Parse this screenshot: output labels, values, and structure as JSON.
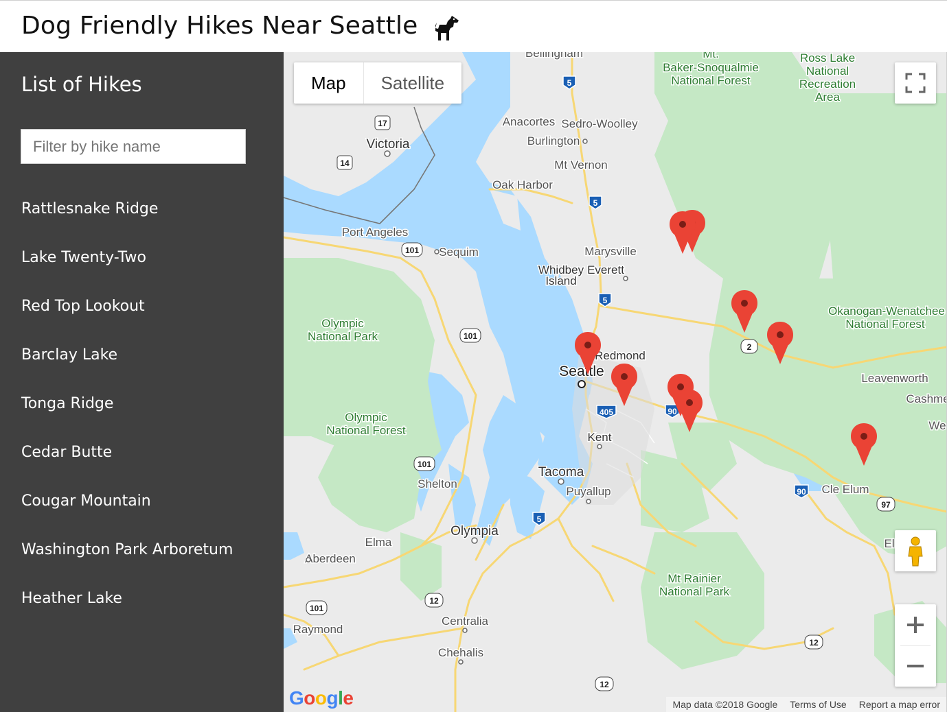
{
  "header": {
    "title": "Dog Friendly Hikes Near Seattle",
    "icon": "dog-icon"
  },
  "sidebar": {
    "heading": "List of Hikes",
    "filter_placeholder": "Filter by hike name",
    "filter_value": "",
    "hikes": [
      "Rattlesnake Ridge",
      "Lake Twenty-Two",
      "Red Top Lookout",
      "Barclay Lake",
      "Tonga Ridge",
      "Cedar Butte",
      "Cougar Mountain",
      "Washington Park Arboretum",
      "Heather Lake"
    ]
  },
  "map": {
    "type_control": {
      "map_label": "Map",
      "satellite_label": "Satellite",
      "selected": "Map"
    },
    "attribution": {
      "map_data": "Map data ©2018 Google",
      "terms": "Terms of Use",
      "report": "Report a map error"
    },
    "logo_letters": [
      "G",
      "o",
      "o",
      "g",
      "l",
      "e"
    ],
    "marker_count": 10,
    "labels": [
      {
        "id": "bellingham",
        "text": "Bellingham",
        "kind": "city"
      },
      {
        "id": "mt-baker-1",
        "text": "Mt.",
        "kind": "park"
      },
      {
        "id": "mt-baker-2",
        "text": "Baker-Snoqualmie",
        "kind": "park"
      },
      {
        "id": "mt-baker-3",
        "text": "National Forest",
        "kind": "park"
      },
      {
        "id": "ross-1",
        "text": "Ross Lake",
        "kind": "park"
      },
      {
        "id": "ross-2",
        "text": "National",
        "kind": "park"
      },
      {
        "id": "ross-3",
        "text": "Recreation",
        "kind": "park"
      },
      {
        "id": "ross-4",
        "text": "Area",
        "kind": "park"
      },
      {
        "id": "victoria",
        "text": "Victoria",
        "kind": "city-major"
      },
      {
        "id": "anacortes",
        "text": "Anacortes",
        "kind": "city"
      },
      {
        "id": "sedro",
        "text": "Sedro-Woolley",
        "kind": "city"
      },
      {
        "id": "burlington",
        "text": "Burlington",
        "kind": "city"
      },
      {
        "id": "mtvernon",
        "text": "Mt Vernon",
        "kind": "city"
      },
      {
        "id": "oakharbor",
        "text": "Oak Harbor",
        "kind": "city"
      },
      {
        "id": "portangeles",
        "text": "Port Angeles",
        "kind": "city"
      },
      {
        "id": "sequim",
        "text": "Sequim",
        "kind": "city"
      },
      {
        "id": "marysville",
        "text": "Marysville",
        "kind": "city"
      },
      {
        "id": "whidbey-1",
        "text": "Whidbey",
        "kind": "city-dark"
      },
      {
        "id": "whidbey-2",
        "text": "Island",
        "kind": "city-dark"
      },
      {
        "id": "everett",
        "text": "Everett",
        "kind": "city-dark"
      },
      {
        "id": "olympic-np-1",
        "text": "Olympic",
        "kind": "park"
      },
      {
        "id": "olympic-np-2",
        "text": "National Park",
        "kind": "park"
      },
      {
        "id": "okanogan-1",
        "text": "Okanogan-Wenatchee",
        "kind": "park"
      },
      {
        "id": "okanogan-2",
        "text": "National Forest",
        "kind": "park"
      },
      {
        "id": "redmond",
        "text": "Redmond",
        "kind": "city-dark"
      },
      {
        "id": "seattle",
        "text": "Seattle",
        "kind": "city-major"
      },
      {
        "id": "leavenworth",
        "text": "Leavenworth",
        "kind": "city"
      },
      {
        "id": "cashmere",
        "text": "Cashme",
        "kind": "city"
      },
      {
        "id": "olympic-nf-1",
        "text": "Olympic",
        "kind": "park"
      },
      {
        "id": "olympic-nf-2",
        "text": "National Forest",
        "kind": "park"
      },
      {
        "id": "kent",
        "text": "Kent",
        "kind": "city-dark"
      },
      {
        "id": "we",
        "text": "We",
        "kind": "city"
      },
      {
        "id": "shelton",
        "text": "Shelton",
        "kind": "city"
      },
      {
        "id": "tacoma",
        "text": "Tacoma",
        "kind": "city-major"
      },
      {
        "id": "puyallup",
        "text": "Puyallup",
        "kind": "city"
      },
      {
        "id": "cle-elum",
        "text": "Cle Elum",
        "kind": "city"
      },
      {
        "id": "olympia",
        "text": "Olympia",
        "kind": "city-major"
      },
      {
        "id": "elma",
        "text": "Elma",
        "kind": "city"
      },
      {
        "id": "aberdeen",
        "text": "Aberdeen",
        "kind": "city"
      },
      {
        "id": "el",
        "text": "El",
        "kind": "city"
      },
      {
        "id": "rainier-1",
        "text": "Mt Rainier",
        "kind": "park"
      },
      {
        "id": "rainier-2",
        "text": "National Park",
        "kind": "park"
      },
      {
        "id": "centralia",
        "text": "Centralia",
        "kind": "city"
      },
      {
        "id": "raymond",
        "text": "Raymond",
        "kind": "city"
      },
      {
        "id": "chehalis",
        "text": "Chehalis",
        "kind": "city"
      }
    ],
    "shields": [
      {
        "id": "i5-a",
        "text": "5",
        "kind": "interstate"
      },
      {
        "id": "hwy17",
        "text": "17",
        "kind": "state"
      },
      {
        "id": "hwy14",
        "text": "14",
        "kind": "state"
      },
      {
        "id": "i5-b",
        "text": "5",
        "kind": "interstate"
      },
      {
        "id": "us101-a",
        "text": "101",
        "kind": "us"
      },
      {
        "id": "i5-c",
        "text": "5",
        "kind": "interstate"
      },
      {
        "id": "us101-b",
        "text": "101",
        "kind": "us"
      },
      {
        "id": "us2",
        "text": "2",
        "kind": "us"
      },
      {
        "id": "i405",
        "text": "405",
        "kind": "interstate"
      },
      {
        "id": "i90-a",
        "text": "90",
        "kind": "interstate"
      },
      {
        "id": "us101-c",
        "text": "101",
        "kind": "us"
      },
      {
        "id": "i90-b",
        "text": "90",
        "kind": "interstate"
      },
      {
        "id": "us97",
        "text": "97",
        "kind": "us"
      },
      {
        "id": "i5-d",
        "text": "5",
        "kind": "interstate"
      },
      {
        "id": "us12-a",
        "text": "12",
        "kind": "us"
      },
      {
        "id": "us101-d",
        "text": "101",
        "kind": "us"
      },
      {
        "id": "us12-b",
        "text": "12",
        "kind": "us"
      },
      {
        "id": "us12-c",
        "text": "12",
        "kind": "us"
      }
    ]
  },
  "colors": {
    "sidebar_bg": "#404040",
    "water": "#aadaff",
    "park": "#c5e8c5",
    "land": "#ebebeb",
    "road": "#fde293",
    "marker": "#ea4335",
    "park_text": "#137333"
  }
}
